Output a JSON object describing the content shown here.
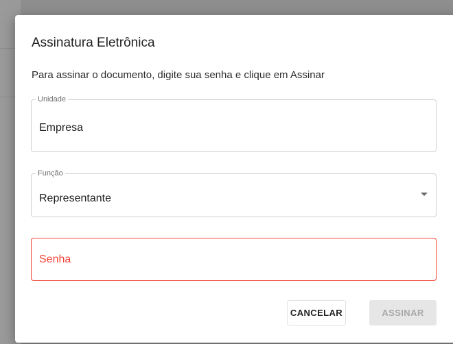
{
  "dialog": {
    "title": "Assinatura Eletrônica",
    "subtitle": "Para assinar o documento, digite sua senha e clique em Assinar"
  },
  "fields": {
    "unidade": {
      "label": "Unidade",
      "value": "Empresa"
    },
    "funcao": {
      "label": "Função",
      "value": "Representante"
    },
    "senha": {
      "label": "Senha",
      "value": ""
    }
  },
  "actions": {
    "cancel_label": "CANCELAR",
    "sign_label": "ASSINAR"
  },
  "colors": {
    "error": "#f44336",
    "disabled_bg": "#e6e6e6",
    "disabled_text": "#a8a8a8"
  }
}
